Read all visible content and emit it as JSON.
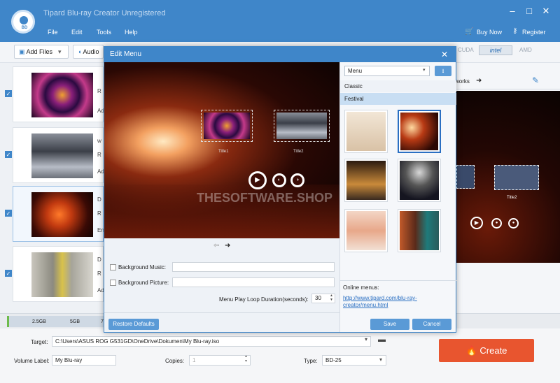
{
  "app": {
    "title": "Tipard Blu-ray Creator Unregistered",
    "logo_text": "BD",
    "menu": [
      "File",
      "Edit",
      "Tools",
      "Help"
    ],
    "buy_now": "Buy Now",
    "register": "Register"
  },
  "toolbar": {
    "add_files": "Add Files",
    "audio": "Audio",
    "gpu_labels": [
      "CUDA",
      "intel",
      "AMD"
    ],
    "works_label": "works"
  },
  "file_list": {
    "items": [
      {
        "labels": [
          "R",
          "Ad"
        ],
        "checked": true
      },
      {
        "labels": [
          "w",
          "R",
          "Ad"
        ],
        "checked": true
      },
      {
        "labels": [
          "D",
          "R",
          "En"
        ],
        "checked": true
      },
      {
        "labels": [
          "D",
          "R",
          "Ad"
        ],
        "checked": true
      }
    ]
  },
  "storage": {
    "ticks": [
      "2.5GB",
      "5GB",
      "7"
    ]
  },
  "bottom": {
    "target_label": "Target:",
    "target_value": "C:\\Users\\ASUS ROG G531GD\\OneDrive\\Dokumen\\My Blu-ray.iso",
    "volume_label": "Volume Label:",
    "volume_value": "My Blu-ray",
    "copies_label": "Copies:",
    "copies_value": "1",
    "type_label": "Type:",
    "type_value": "BD-25",
    "create": "Create"
  },
  "right_preview": {
    "title_caption": "Title2"
  },
  "dialog": {
    "title": "Edit Menu",
    "preview": {
      "title1": "Title1",
      "title2": "Title2",
      "watermark": "THESOFTWARE.SHOP"
    },
    "background_music_label": "Background Music:",
    "background_music_value": "",
    "background_picture_label": "Background Picture:",
    "background_picture_value": "",
    "loop_label": "Menu Play Loop Duration(seconds):",
    "loop_value": "30",
    "restore_defaults": "Restore Defaults",
    "save": "Save",
    "cancel": "Cancel",
    "menu_select": "Menu",
    "categories": [
      {
        "label": "Classic",
        "selected": false
      },
      {
        "label": "Festival",
        "selected": true
      }
    ],
    "online_menus_label": "Online menus:",
    "online_menus_link": "http://www.tipard.com/blu-ray-creator/menu.html"
  },
  "colors": {
    "accent": "#3f86c9",
    "create": "#e8552f",
    "selected_category": "#c8def3"
  }
}
